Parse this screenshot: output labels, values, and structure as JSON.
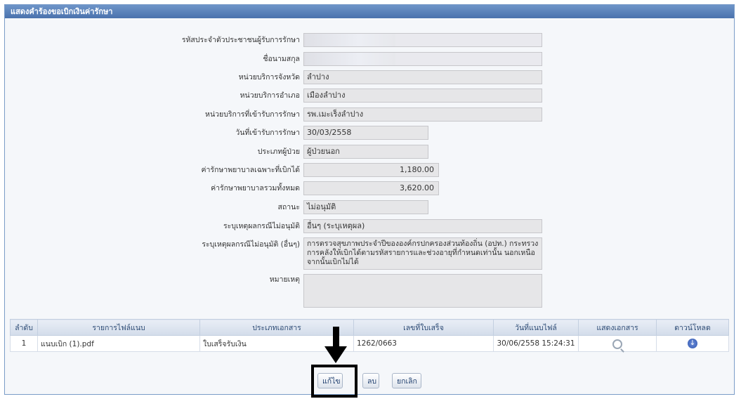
{
  "panel": {
    "title": "แสดงคำร้องขอเบิกเงินค่ารักษา"
  },
  "form": {
    "fields": [
      {
        "label": "รหัสประจำตัวประชาชนผู้รับการรักษา",
        "value": ""
      },
      {
        "label": "ชื่อนามสกุล",
        "value": ""
      },
      {
        "label": "หน่วยบริการจังหวัด",
        "value": "ลำปาง"
      },
      {
        "label": "หน่วยบริการอำเภอ",
        "value": "เมืองลำปาง"
      },
      {
        "label": "หน่วยบริการที่เข้ารับการรักษา",
        "value": "รพ.เมะเร็งลำปาง"
      },
      {
        "label": "วันที่เข้ารับการรักษา",
        "value": "30/03/2558"
      },
      {
        "label": "ประเภทผู้ป่วย",
        "value": "ผู้ป่วยนอก"
      },
      {
        "label": "ค่ารักษาพยาบาลเฉพาะที่เบิกได้",
        "value": "1,180.00"
      },
      {
        "label": "ค่ารักษาพยาบาลรวมทั้งหมด",
        "value": "3,620.00"
      },
      {
        "label": "สถานะ",
        "value": "ไม่อนุมัติ"
      },
      {
        "label": "ระบุเหตุผลกรณีไม่อนุมัติ",
        "value": "อื่นๆ (ระบุเหตุผล)"
      },
      {
        "label": "ระบุเหตุผลกรณีไม่อนุมัติ (อื่นๆ)",
        "value": "การตรวจสุขภาพประจำปีขององค์กรปกครองส่วนท้องถิ่น (อปท.) กระทรวงการคลังให้เบิกได้ตามรหัสรายการและช่วงอายุที่กำหนดเท่านั้น นอกเหนือจากนั้นเบิกไม่ได้"
      },
      {
        "label": "หมายเหตุ",
        "value": ""
      }
    ]
  },
  "files_table": {
    "headers": [
      "ลำดับ",
      "รายการไฟล์แนบ",
      "ประเภทเอกสาร",
      "เลขที่ใบเสร็จ",
      "วันที่แนบไฟล์",
      "แสดงเอกสาร",
      "ดาวน์โหลด"
    ],
    "rows": [
      {
        "no": "1",
        "file": "แนบเบิก (1).pdf",
        "doc_type": "ใบเสร็จรับเงิน",
        "receipt_no": "1262/0663",
        "date": "30/06/2558 15:24:31"
      }
    ]
  },
  "buttons": {
    "edit": "แก้ไข",
    "delete": "ลบ",
    "cancel": "ยกเลิก"
  },
  "icons": {
    "view": "magnifier-icon",
    "download": "download-arrow-icon",
    "callout": "down-arrow-icon"
  },
  "colors": {
    "header": "#4a72ad",
    "field_bg": "#e6e6e8"
  }
}
